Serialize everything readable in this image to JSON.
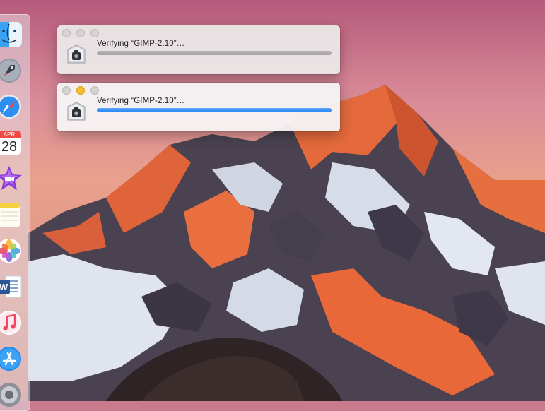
{
  "dock": {
    "items": [
      {
        "name": "finder-icon"
      },
      {
        "name": "launchpad-icon"
      },
      {
        "name": "safari-icon"
      },
      {
        "name": "calendar-icon",
        "month": "APR",
        "day": "28"
      },
      {
        "name": "imovie-icon"
      },
      {
        "name": "notes-icon"
      },
      {
        "name": "photos-icon"
      },
      {
        "name": "word-icon",
        "letter": "W"
      },
      {
        "name": "itunes-icon"
      },
      {
        "name": "app-store-icon"
      },
      {
        "name": "system-preferences-icon"
      }
    ]
  },
  "windows": [
    {
      "title": "Verifying “GIMP-2.10”…",
      "active": false,
      "progress": 1.0,
      "fill_color": "#a9a7a7"
    },
    {
      "title": "Verifying “GIMP-2.10”…",
      "active": true,
      "progress": 1.0,
      "fill_color": "#1f7ef4"
    }
  ],
  "colors": {
    "accent": "#1f7ef4",
    "minimize_button": "#f6be2f"
  }
}
